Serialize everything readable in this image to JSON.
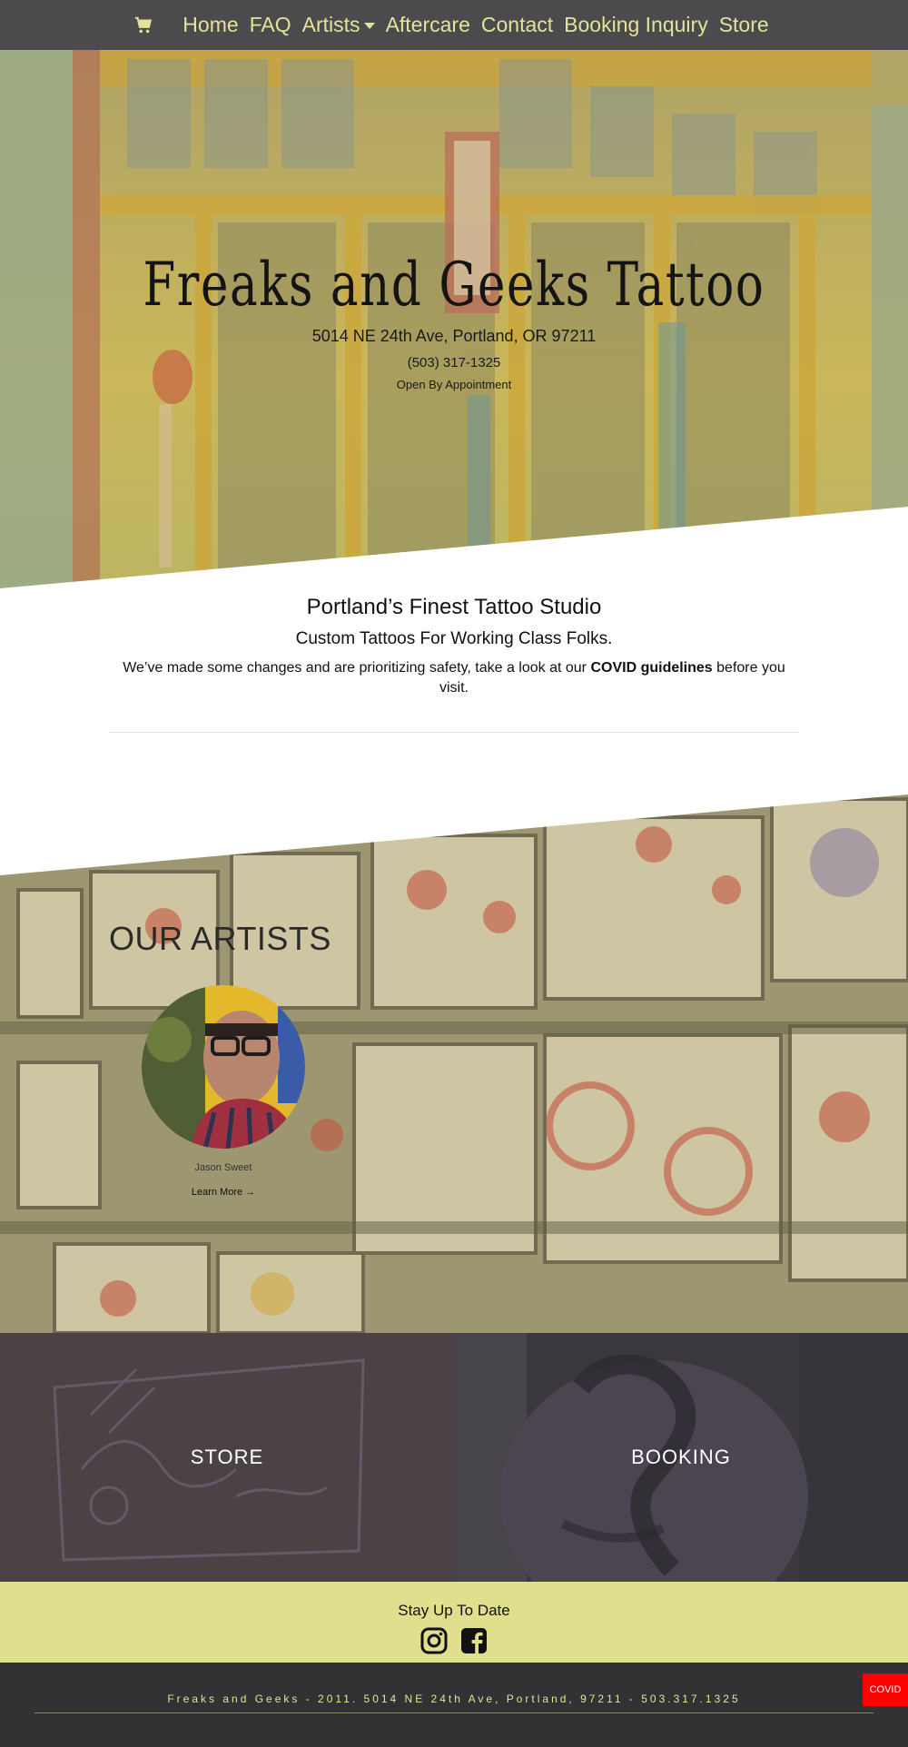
{
  "nav": {
    "cart_icon": "shopping-cart-icon",
    "items": [
      {
        "label": "Home"
      },
      {
        "label": "FAQ"
      },
      {
        "label": "Artists"
      },
      {
        "label": "Aftercare"
      },
      {
        "label": "Contact"
      },
      {
        "label": "Booking Inquiry"
      },
      {
        "label": "Store"
      }
    ],
    "color": "#e4e39a",
    "background": "#4b4a4c"
  },
  "hero": {
    "title": "Freaks and Geeks Tattoo",
    "address": "5014 NE 24th Ave, Portland, OR 97211",
    "phone": "(503) 317-1325",
    "hours": "Open By Appointment"
  },
  "intro": {
    "heading": "Portland’s Finest Tattoo Studio",
    "subheading": "Custom Tattoos For Working Class Folks.",
    "text_before": "We’ve made some changes and are prioritizing safety, take a look at our ",
    "link": "COVID guidelines",
    "text_after": " before you visit."
  },
  "artists": {
    "title": "OUR ARTISTS",
    "list": [
      {
        "name": "Jason Sweet",
        "cta": "Learn More →"
      }
    ]
  },
  "panels": {
    "store": "STORE",
    "booking": "BOOKING"
  },
  "newsletter": {
    "title": "Stay Up To Date",
    "icons": [
      "instagram-icon",
      "facebook-icon"
    ]
  },
  "footer": {
    "text": "Freaks and Geeks - 2011. 5014 NE 24th Ave, Portland, 97211 - 503.317.1325",
    "covid_button": "COVID"
  }
}
